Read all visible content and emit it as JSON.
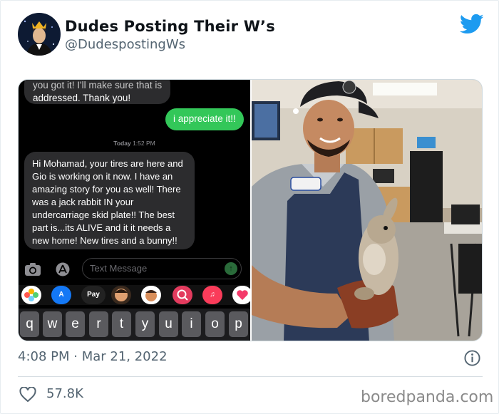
{
  "tweet": {
    "author_name": "Dudes Posting Their W’s",
    "author_handle": "@DudespostingWs",
    "timestamp": "4:08 PM · Mar 21, 2022",
    "likes": "57.8K"
  },
  "screenshot": {
    "msg_top_cut": "you got it! I'll make sure that is",
    "msg_top": "addressed. Thank you!",
    "msg_sent": "i appreciate it!!",
    "timestamp_day": "Today",
    "timestamp_time": "1:52 PM",
    "msg_long": "Hi Mohamad, your tires are here and Gio is working on it now. I have an amazing story for you as well! There was a jack rabbit IN your undercarriage skid plate!! The best part is...its ALIVE and it it needs a new home! New tires and a bunny!!",
    "input_placeholder": "Text Message",
    "apple_pay_label": "Pay",
    "keys": [
      "q",
      "w",
      "e",
      "r",
      "t",
      "y",
      "u",
      "i",
      "o",
      "p"
    ]
  },
  "watermark": "boredpanda.com",
  "colors": {
    "twitter_blue": "#1d9bf0",
    "imessage_green": "#33c759",
    "imessage_gray": "#2c2c2e",
    "meta_text": "#536471"
  },
  "icons": {
    "logo": "twitter-bird-icon",
    "info": "info-circle-icon",
    "like": "heart-icon",
    "camera": "camera-icon",
    "appstore": "app-store-icon"
  }
}
